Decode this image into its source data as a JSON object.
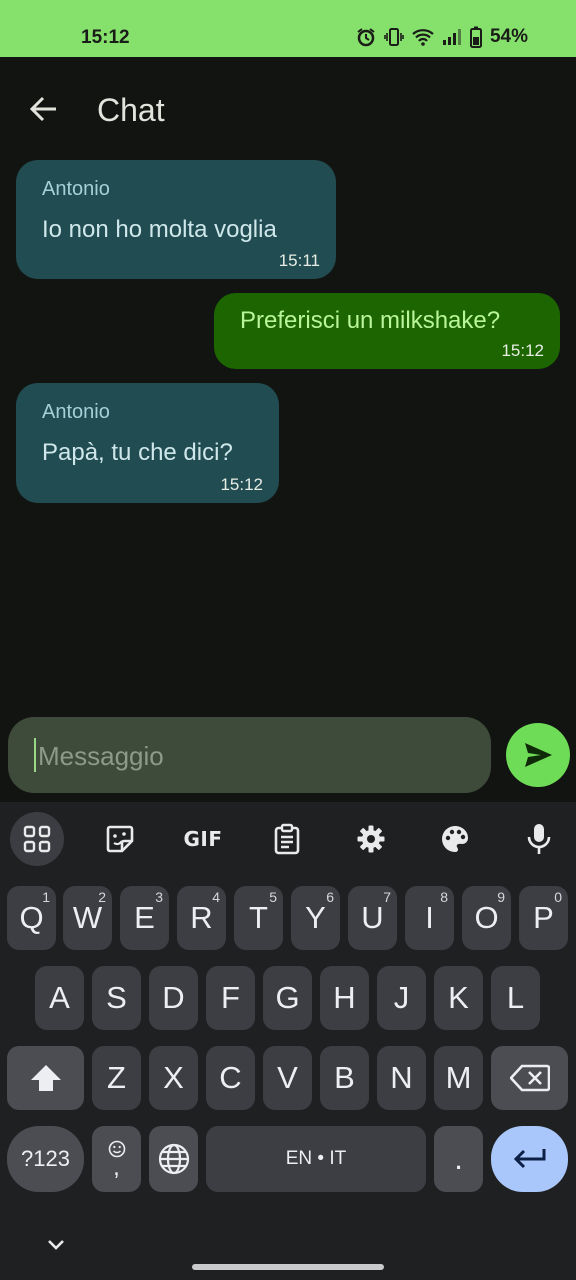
{
  "status_bar": {
    "time": "15:12",
    "battery": "54%"
  },
  "app_bar": {
    "title": "Chat"
  },
  "messages": [
    {
      "sender": "Antonio",
      "text": "Io non ho molta voglia",
      "time": "15:11",
      "direction": "incoming"
    },
    {
      "sender": "",
      "text": "Preferisci un milkshake?",
      "time": "15:12",
      "direction": "outgoing"
    },
    {
      "sender": "Antonio",
      "text": "Papà, tu che dici?",
      "time": "15:12",
      "direction": "incoming"
    }
  ],
  "composer": {
    "placeholder": "Messaggio",
    "value": ""
  },
  "keyboard": {
    "toolbar": [
      "apps-grid-icon",
      "sticker-icon",
      "GIF",
      "clipboard-icon",
      "gear-icon",
      "palette-icon",
      "microphone-icon"
    ],
    "gif_label": "GIF",
    "row1": [
      {
        "label": "Q",
        "hint": "1"
      },
      {
        "label": "W",
        "hint": "2"
      },
      {
        "label": "E",
        "hint": "3"
      },
      {
        "label": "R",
        "hint": "4"
      },
      {
        "label": "T",
        "hint": "5"
      },
      {
        "label": "Y",
        "hint": "6"
      },
      {
        "label": "U",
        "hint": "7"
      },
      {
        "label": "I",
        "hint": "8"
      },
      {
        "label": "O",
        "hint": "9"
      },
      {
        "label": "P",
        "hint": "0"
      }
    ],
    "row2": [
      "A",
      "S",
      "D",
      "F",
      "G",
      "H",
      "J",
      "K",
      "L"
    ],
    "row3": [
      "Z",
      "X",
      "C",
      "V",
      "B",
      "N",
      "M"
    ],
    "symbols_label": "?123",
    "emoji_comma": ",",
    "space_label": "EN • IT",
    "period_label": "."
  },
  "colors": {
    "accent": "#86e06c",
    "incoming_bubble": "#214d52",
    "outgoing_bubble": "#1c6500",
    "send_button": "#6fdc57",
    "enter_key": "#a9c7fb"
  }
}
